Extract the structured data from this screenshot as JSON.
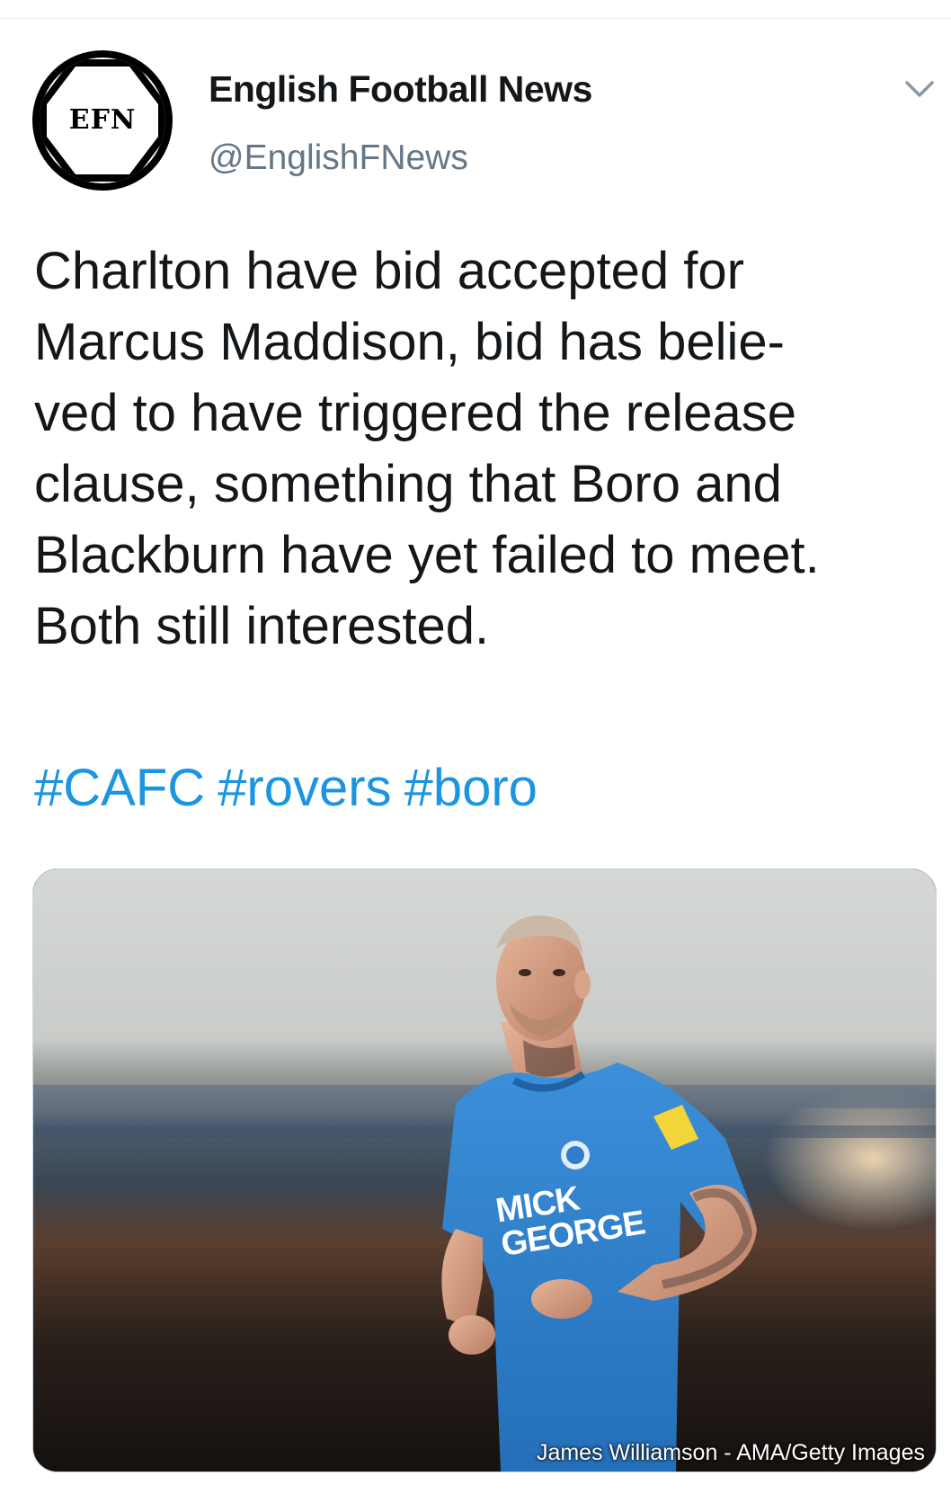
{
  "tweet": {
    "author": {
      "display_name": "English Football News",
      "handle": "@EnglishFNews",
      "avatar_text": "EFN"
    },
    "menu_icon": "chevron-down-icon",
    "text_lines": [
      "Charlton have bid accepted for",
      "Marcus Maddison, bid has belie-",
      "ved to have triggered the release",
      "clause, something that Boro and",
      "Blackburn have yet failed to meet.",
      "Both still interested."
    ],
    "hashtags": [
      "#CAFC",
      "#rovers",
      "#boro"
    ],
    "media": {
      "kit_sponsor_line1": "MICK",
      "kit_sponsor_line2": "GEORGE",
      "credit": "James Williamson - AMA/Getty Images"
    }
  },
  "colors": {
    "text": "#14171a",
    "secondary": "#657786",
    "link": "#1b95e0",
    "kit_blue": "#2e7ec9",
    "divider": "#e6ecf0"
  }
}
